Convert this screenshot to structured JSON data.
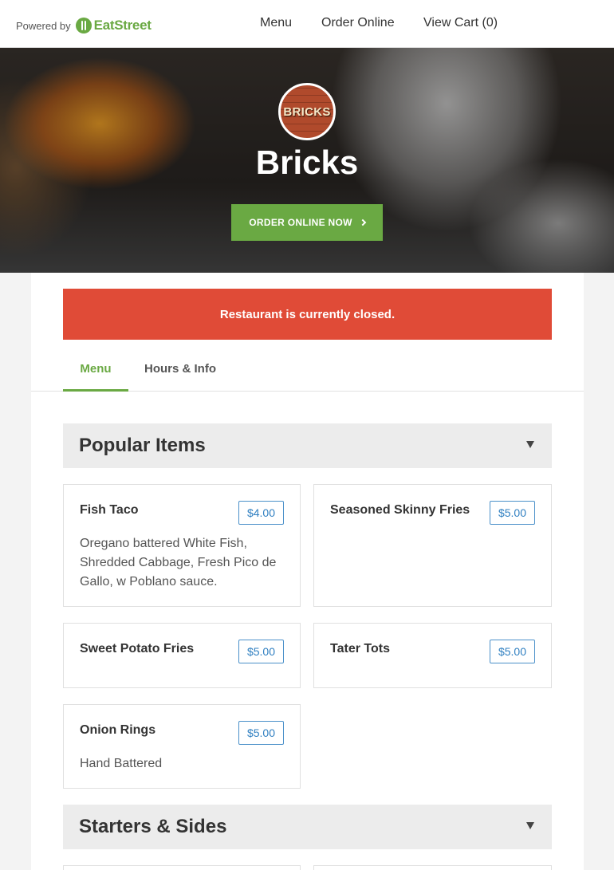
{
  "topbar": {
    "powered_label": "Powered by",
    "brand": "EatStreet",
    "nav": [
      "Menu",
      "Order Online",
      "View Cart (0)"
    ]
  },
  "hero": {
    "logo_text": "BRICKS",
    "title": "Bricks",
    "order_button": "ORDER ONLINE NOW"
  },
  "alert": {
    "text": "Restaurant is currently closed."
  },
  "tabs": [
    "Menu",
    "Hours & Info"
  ],
  "sections": [
    {
      "title": "Popular Items",
      "items": [
        {
          "name": "Fish Taco",
          "price": "$4.00",
          "description": "Oregano battered White Fish, Shredded Cabbage, Fresh Pico de Gallo, w Poblano sauce."
        },
        {
          "name": "Seasoned Skinny Fries",
          "price": "$5.00",
          "description": ""
        },
        {
          "name": "Sweet Potato Fries",
          "price": "$5.00",
          "description": ""
        },
        {
          "name": "Tater Tots",
          "price": "$5.00",
          "description": ""
        },
        {
          "name": "Onion Rings",
          "price": "$5.00",
          "description": "Hand Battered"
        }
      ]
    },
    {
      "title": "Starters & Sides",
      "items": []
    }
  ],
  "colors": {
    "brand_green": "#6aa943",
    "alert_red": "#e04b37",
    "price_blue": "#2f7fc1"
  },
  "icons": [
    "eatstreet-logo-icon",
    "chevron-right-icon",
    "caret-down-icon"
  ]
}
